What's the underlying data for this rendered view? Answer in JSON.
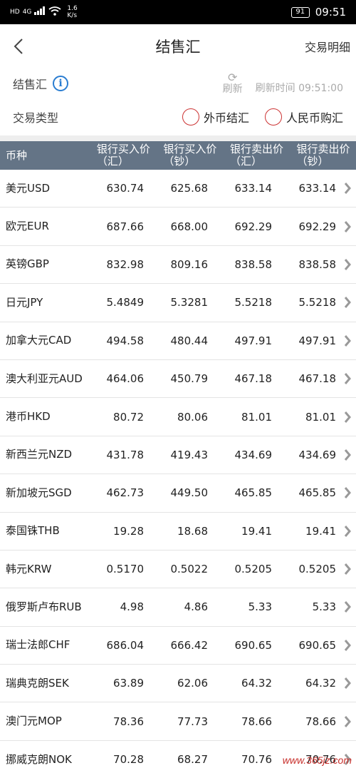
{
  "status_bar": {
    "network": "HD",
    "signal_label": "4G",
    "speed_value": "1.6",
    "speed_unit": "K/s",
    "battery": "91",
    "time": "09:51"
  },
  "header": {
    "title": "结售汇",
    "right_action": "交易明细"
  },
  "info": {
    "label": "结售汇",
    "refresh_label": "刷新",
    "refresh_time": "刷新时间 09:51:00",
    "trade_type_label": "交易类型",
    "options": [
      "外币结汇",
      "人民币购汇"
    ]
  },
  "table": {
    "headers": {
      "currency": "币种",
      "buy_transfer": "银行买入价（汇）",
      "buy_cash": "银行买入价（钞）",
      "sell_transfer": "银行卖出价（汇）",
      "sell_cash": "银行卖出价（钞）"
    },
    "rows": [
      {
        "currency": "美元USD",
        "buy_transfer": "630.74",
        "buy_cash": "625.68",
        "sell_transfer": "633.14",
        "sell_cash": "633.14"
      },
      {
        "currency": "欧元EUR",
        "buy_transfer": "687.66",
        "buy_cash": "668.00",
        "sell_transfer": "692.29",
        "sell_cash": "692.29"
      },
      {
        "currency": "英镑GBP",
        "buy_transfer": "832.98",
        "buy_cash": "809.16",
        "sell_transfer": "838.58",
        "sell_cash": "838.58"
      },
      {
        "currency": "日元JPY",
        "buy_transfer": "5.4849",
        "buy_cash": "5.3281",
        "sell_transfer": "5.5218",
        "sell_cash": "5.5218"
      },
      {
        "currency": "加拿大元CAD",
        "buy_transfer": "494.58",
        "buy_cash": "480.44",
        "sell_transfer": "497.91",
        "sell_cash": "497.91"
      },
      {
        "currency": "澳大利亚元AUD",
        "buy_transfer": "464.06",
        "buy_cash": "450.79",
        "sell_transfer": "467.18",
        "sell_cash": "467.18"
      },
      {
        "currency": "港币HKD",
        "buy_transfer": "80.72",
        "buy_cash": "80.06",
        "sell_transfer": "81.01",
        "sell_cash": "81.01"
      },
      {
        "currency": "新西兰元NZD",
        "buy_transfer": "431.78",
        "buy_cash": "419.43",
        "sell_transfer": "434.69",
        "sell_cash": "434.69"
      },
      {
        "currency": "新加坡元SGD",
        "buy_transfer": "462.73",
        "buy_cash": "449.50",
        "sell_transfer": "465.85",
        "sell_cash": "465.85"
      },
      {
        "currency": "泰国铢THB",
        "buy_transfer": "19.28",
        "buy_cash": "18.68",
        "sell_transfer": "19.41",
        "sell_cash": "19.41"
      },
      {
        "currency": "韩元KRW",
        "buy_transfer": "0.5170",
        "buy_cash": "0.5022",
        "sell_transfer": "0.5205",
        "sell_cash": "0.5205"
      },
      {
        "currency": "俄罗斯卢布RUB",
        "buy_transfer": "4.98",
        "buy_cash": "4.86",
        "sell_transfer": "5.33",
        "sell_cash": "5.33"
      },
      {
        "currency": "瑞士法郎CHF",
        "buy_transfer": "686.04",
        "buy_cash": "666.42",
        "sell_transfer": "690.65",
        "sell_cash": "690.65"
      },
      {
        "currency": "瑞典克朗SEK",
        "buy_transfer": "63.89",
        "buy_cash": "62.06",
        "sell_transfer": "64.32",
        "sell_cash": "64.32"
      },
      {
        "currency": "澳门元MOP",
        "buy_transfer": "78.36",
        "buy_cash": "77.73",
        "sell_transfer": "78.66",
        "sell_cash": "78.66"
      },
      {
        "currency": "挪威克朗NOK",
        "buy_transfer": "70.28",
        "buy_cash": "68.27",
        "sell_transfer": "70.76",
        "sell_cash": "70.76"
      }
    ]
  },
  "watermark": "www.365jz.com",
  "colors": {
    "table_header_bg": "#647486",
    "radio_border": "#cc3333",
    "info_icon": "#2a7dd1",
    "watermark": "#c8302c"
  }
}
